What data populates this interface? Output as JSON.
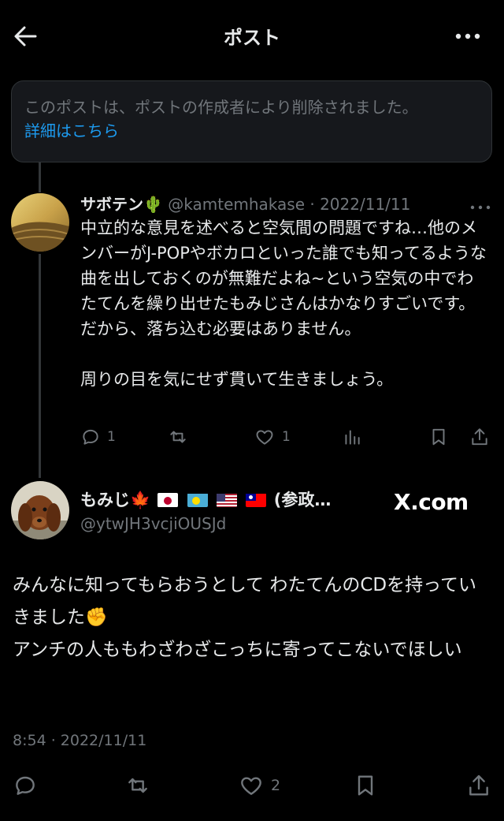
{
  "header": {
    "title": "ポスト",
    "back_icon": "arrow-left-icon",
    "more_icon": "more-horizontal-icon"
  },
  "deleted_notice": {
    "text": "このポストは、ポストの作成者により削除されました。",
    "link": "詳細はこちら"
  },
  "reply": {
    "name": "サボテン🌵",
    "handle_date": "@kamtemhakase · 2022/11/11",
    "body": "中立的な意見を述べると空気間の問題ですね…他のメンバーがJ-POPやボカロといった誰でも知ってるような曲を出しておくのが無難だよね~という空気の中でわたてんを繰り出せたもみじさんはかなりすごいです。だから、落ち込む必要はありません。\n\n周りの目を気にせず貫いて生きましょう。",
    "reply_count": "1",
    "retweet_count": "",
    "like_count": "1"
  },
  "main_post": {
    "name": "もみじ🍁",
    "name_suffix": "(参政…",
    "flags": [
      "japan-flag-icon",
      "palau-flag-icon",
      "usa-flag-icon",
      "taiwan-flag-icon"
    ],
    "handle": "@ytwJH3vcjiOUSJd",
    "watermark": "X.com",
    "body": "みんなに知ってもらおうとして わたてんのCDを持っていきました✊\nアンチの人ももわざわざこっちに寄ってこないでほしい",
    "timestamp": "8:54 · 2022/11/11",
    "like_count": "2"
  },
  "colors": {
    "background": "#000000",
    "text": "#e7e9ea",
    "muted": "#71767b",
    "link": "#1d9bf0",
    "border": "#2f3336"
  }
}
